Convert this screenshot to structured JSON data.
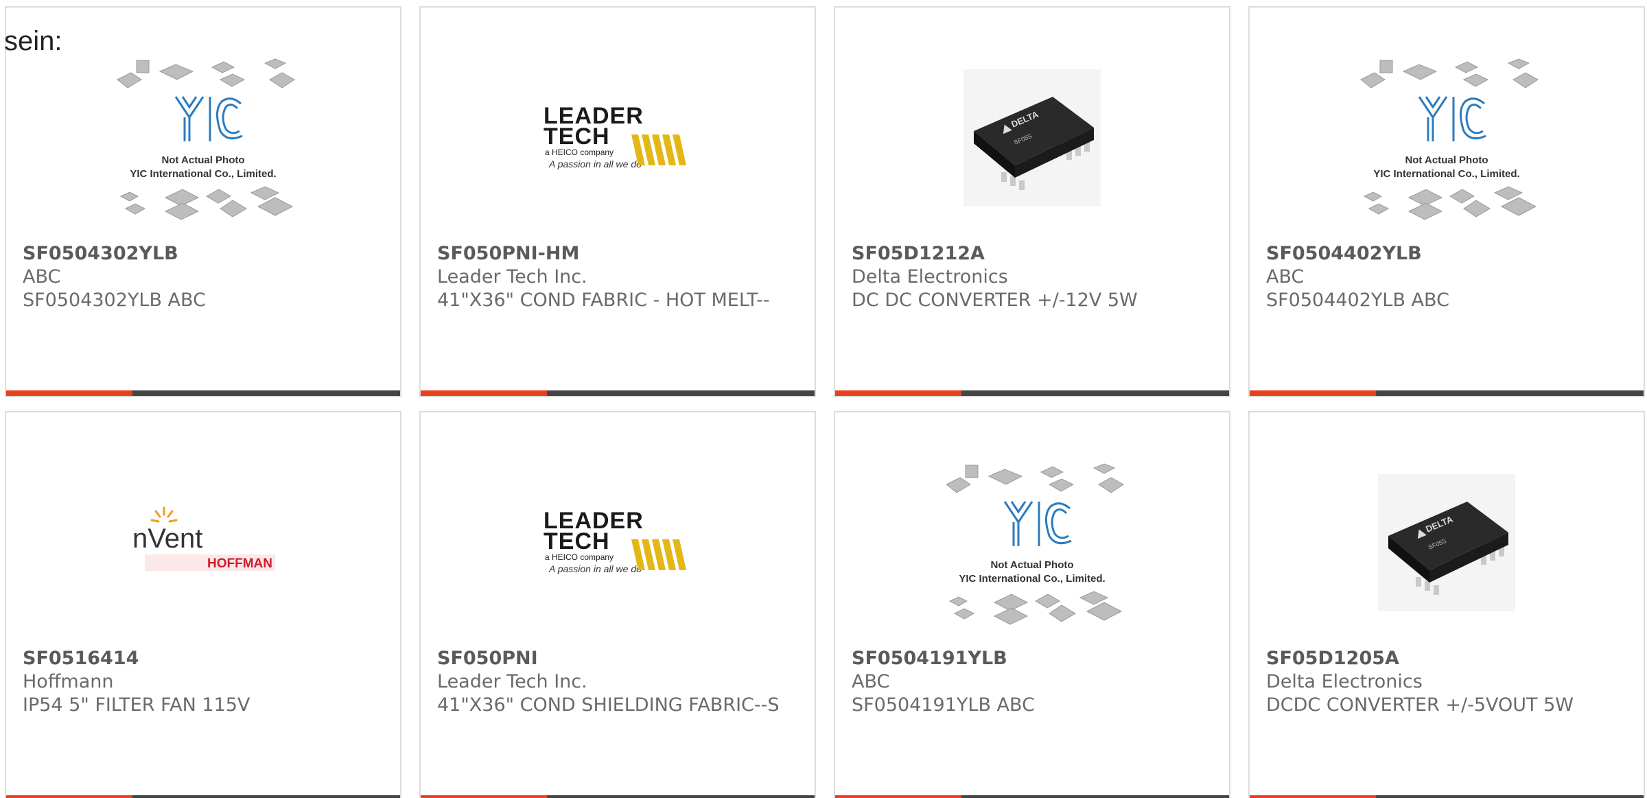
{
  "lead_text": "sein:",
  "colors": {
    "accent": "#e8401c",
    "bar_dark": "#444444",
    "card_border": "#dcdcdc",
    "text_gray": "#6a6a6a"
  },
  "accent_fill_fraction": 0.32,
  "placeholder": {
    "line1": "Not Actual Photo",
    "line2": "YIC International Co., Limited.",
    "logo": "YIC"
  },
  "logos": {
    "leader_top": "LEADER",
    "leader_mid": "TECH",
    "leader_sub": "a HEICO company",
    "leader_tag": "A passion in all we do",
    "nvent": "nVent",
    "hoffman": "HOFFMAN",
    "delta_brand": "DELTA",
    "delta_model": "SF05S"
  },
  "products": [
    {
      "part": "SF0504302YLB",
      "maker": "ABC",
      "desc": "SF0504302YLB ABC",
      "image": "placeholder-icon"
    },
    {
      "part": "SF050PNI-HM",
      "maker": "Leader Tech Inc.",
      "desc": "41\"X36\" COND FABRIC - HOT MELT--",
      "image": "leader-tech-logo-icon"
    },
    {
      "part": "SF05D1212A",
      "maker": "Delta Electronics",
      "desc": "DC DC CONVERTER +/-12V 5W",
      "image": "delta-module-icon"
    },
    {
      "part": "SF0504402YLB",
      "maker": "ABC",
      "desc": "SF0504402YLB ABC",
      "image": "placeholder-icon"
    },
    {
      "part": "SF0516414",
      "maker": "Hoffmann",
      "desc": "IP54 5\" FILTER FAN 115V",
      "image": "nvent-hoffman-logo-icon"
    },
    {
      "part": "SF050PNI",
      "maker": "Leader Tech Inc.",
      "desc": "41\"X36\" COND SHIELDING FABRIC--S",
      "image": "leader-tech-logo-icon"
    },
    {
      "part": "SF0504191YLB",
      "maker": "ABC",
      "desc": "SF0504191YLB ABC",
      "image": "placeholder-icon"
    },
    {
      "part": "SF05D1205A",
      "maker": "Delta Electronics",
      "desc": "DCDC CONVERTER +/-5VOUT 5W",
      "image": "delta-module-icon"
    }
  ]
}
